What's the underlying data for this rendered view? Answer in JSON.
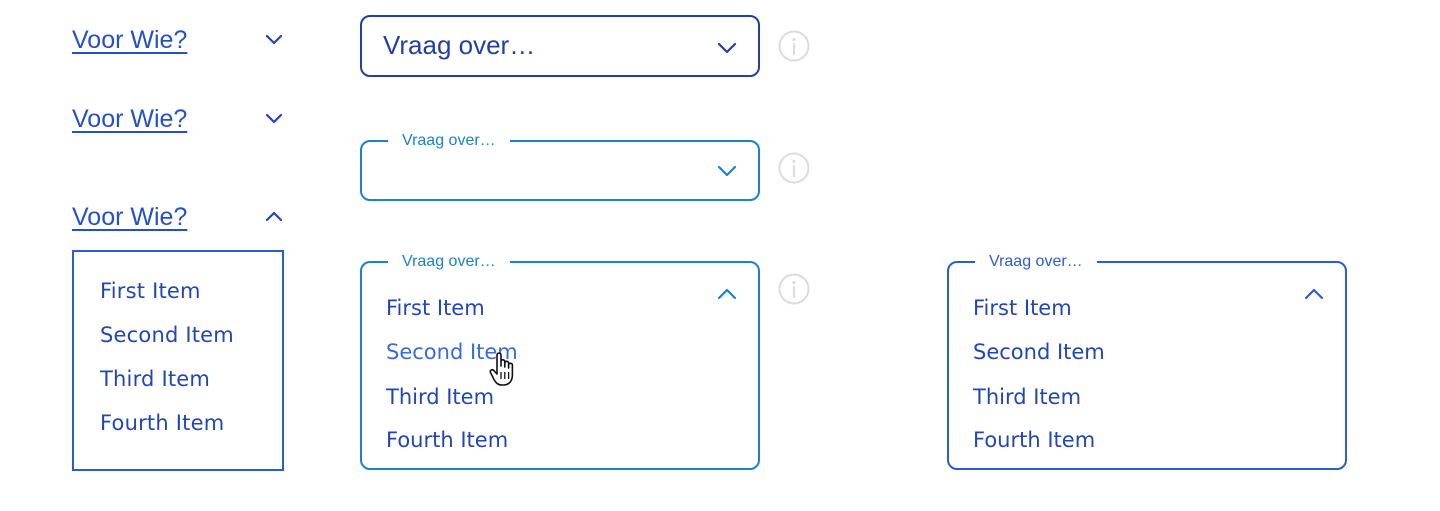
{
  "colors": {
    "link": "#2750c7",
    "dark_border": "#23409a",
    "light_border": "#1a82cf",
    "item_text": "#2346b5",
    "info_icon": "#d9d9d9"
  },
  "left_dropdowns": [
    {
      "label": "Voor Wie?",
      "state": "closed",
      "icon": "chevron-down-icon"
    },
    {
      "label": "Voor Wie?",
      "state": "closed",
      "icon": "chevron-down-icon"
    },
    {
      "label": "Voor Wie?",
      "state": "open",
      "icon": "chevron-up-icon"
    }
  ],
  "left_list": {
    "items": [
      "First Item",
      "Second Item",
      "Third Item",
      "Fourth Item"
    ]
  },
  "select_default": {
    "value": "Vraag over…",
    "icon": "chevron-down-icon"
  },
  "select_focused": {
    "label": "Vraag over…",
    "value": "",
    "icon": "chevron-down-icon"
  },
  "select_open_hover": {
    "label": "Vraag over…",
    "icon": "chevron-up-icon",
    "items": [
      "First Item",
      "Second Item",
      "Third Item",
      "Fourth Item"
    ],
    "hovered_item": "Second Item"
  },
  "select_open": {
    "label": "Vraag over…",
    "icon": "chevron-up-icon",
    "items": [
      "First Item",
      "Second Item",
      "Third Item",
      "Fourth Item"
    ]
  },
  "info": {
    "icon": "info-icon"
  }
}
